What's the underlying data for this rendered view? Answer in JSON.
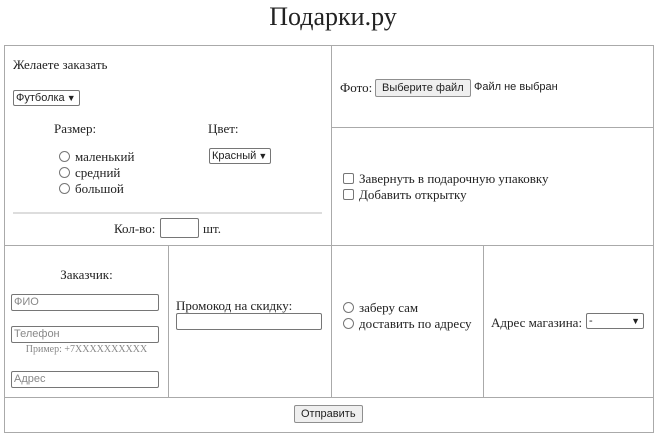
{
  "title": "Подарки.ру",
  "order": {
    "heading": "Желаете заказать",
    "product_select": "Футболка",
    "size_label": "Размер:",
    "sizes": [
      "маленький",
      "средний",
      "большой"
    ],
    "color_label": "Цвет:",
    "color_select": "Красный",
    "qty_label": "Кол-во:",
    "qty_unit": "шт."
  },
  "photo": {
    "label": "Фото:",
    "button": "Выберите файл",
    "status": "Файл не выбран"
  },
  "extras": [
    "Завернуть в подарочную упаковку",
    "Добавить открытку"
  ],
  "customer": {
    "heading": "Заказчик:",
    "name_placeholder": "ФИО",
    "phone_placeholder": "Телефон",
    "phone_hint": "Пример: +7XXXXXXXXXX",
    "address_placeholder": "Адрес"
  },
  "promo": {
    "label": "Промокод на скидку:"
  },
  "delivery": [
    "заберу сам",
    "доставить по адресу"
  ],
  "store": {
    "label": "Адрес магазина:",
    "select": "-"
  },
  "submit": "Отправить"
}
